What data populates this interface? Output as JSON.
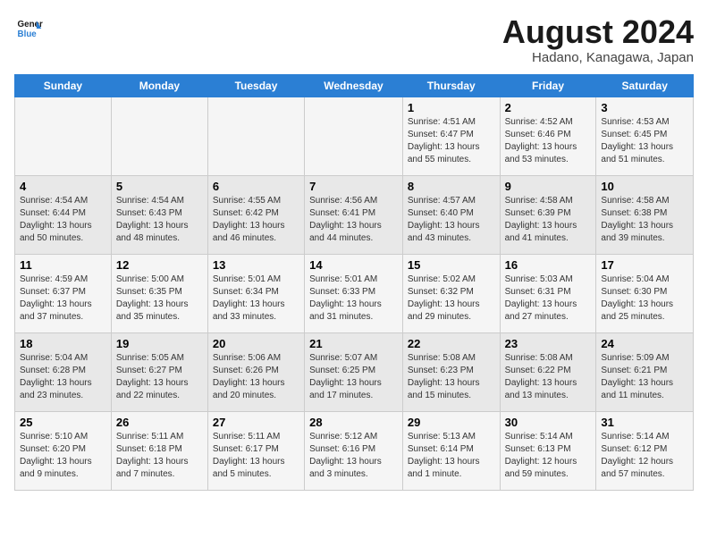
{
  "logo": {
    "line1": "General",
    "line2": "Blue"
  },
  "title": "August 2024",
  "location": "Hadano, Kanagawa, Japan",
  "days_of_week": [
    "Sunday",
    "Monday",
    "Tuesday",
    "Wednesday",
    "Thursday",
    "Friday",
    "Saturday"
  ],
  "weeks": [
    [
      {
        "day": "",
        "info": ""
      },
      {
        "day": "",
        "info": ""
      },
      {
        "day": "",
        "info": ""
      },
      {
        "day": "",
        "info": ""
      },
      {
        "day": "1",
        "info": "Sunrise: 4:51 AM\nSunset: 6:47 PM\nDaylight: 13 hours\nand 55 minutes."
      },
      {
        "day": "2",
        "info": "Sunrise: 4:52 AM\nSunset: 6:46 PM\nDaylight: 13 hours\nand 53 minutes."
      },
      {
        "day": "3",
        "info": "Sunrise: 4:53 AM\nSunset: 6:45 PM\nDaylight: 13 hours\nand 51 minutes."
      }
    ],
    [
      {
        "day": "4",
        "info": "Sunrise: 4:54 AM\nSunset: 6:44 PM\nDaylight: 13 hours\nand 50 minutes."
      },
      {
        "day": "5",
        "info": "Sunrise: 4:54 AM\nSunset: 6:43 PM\nDaylight: 13 hours\nand 48 minutes."
      },
      {
        "day": "6",
        "info": "Sunrise: 4:55 AM\nSunset: 6:42 PM\nDaylight: 13 hours\nand 46 minutes."
      },
      {
        "day": "7",
        "info": "Sunrise: 4:56 AM\nSunset: 6:41 PM\nDaylight: 13 hours\nand 44 minutes."
      },
      {
        "day": "8",
        "info": "Sunrise: 4:57 AM\nSunset: 6:40 PM\nDaylight: 13 hours\nand 43 minutes."
      },
      {
        "day": "9",
        "info": "Sunrise: 4:58 AM\nSunset: 6:39 PM\nDaylight: 13 hours\nand 41 minutes."
      },
      {
        "day": "10",
        "info": "Sunrise: 4:58 AM\nSunset: 6:38 PM\nDaylight: 13 hours\nand 39 minutes."
      }
    ],
    [
      {
        "day": "11",
        "info": "Sunrise: 4:59 AM\nSunset: 6:37 PM\nDaylight: 13 hours\nand 37 minutes."
      },
      {
        "day": "12",
        "info": "Sunrise: 5:00 AM\nSunset: 6:35 PM\nDaylight: 13 hours\nand 35 minutes."
      },
      {
        "day": "13",
        "info": "Sunrise: 5:01 AM\nSunset: 6:34 PM\nDaylight: 13 hours\nand 33 minutes."
      },
      {
        "day": "14",
        "info": "Sunrise: 5:01 AM\nSunset: 6:33 PM\nDaylight: 13 hours\nand 31 minutes."
      },
      {
        "day": "15",
        "info": "Sunrise: 5:02 AM\nSunset: 6:32 PM\nDaylight: 13 hours\nand 29 minutes."
      },
      {
        "day": "16",
        "info": "Sunrise: 5:03 AM\nSunset: 6:31 PM\nDaylight: 13 hours\nand 27 minutes."
      },
      {
        "day": "17",
        "info": "Sunrise: 5:04 AM\nSunset: 6:30 PM\nDaylight: 13 hours\nand 25 minutes."
      }
    ],
    [
      {
        "day": "18",
        "info": "Sunrise: 5:04 AM\nSunset: 6:28 PM\nDaylight: 13 hours\nand 23 minutes."
      },
      {
        "day": "19",
        "info": "Sunrise: 5:05 AM\nSunset: 6:27 PM\nDaylight: 13 hours\nand 22 minutes."
      },
      {
        "day": "20",
        "info": "Sunrise: 5:06 AM\nSunset: 6:26 PM\nDaylight: 13 hours\nand 20 minutes."
      },
      {
        "day": "21",
        "info": "Sunrise: 5:07 AM\nSunset: 6:25 PM\nDaylight: 13 hours\nand 17 minutes."
      },
      {
        "day": "22",
        "info": "Sunrise: 5:08 AM\nSunset: 6:23 PM\nDaylight: 13 hours\nand 15 minutes."
      },
      {
        "day": "23",
        "info": "Sunrise: 5:08 AM\nSunset: 6:22 PM\nDaylight: 13 hours\nand 13 minutes."
      },
      {
        "day": "24",
        "info": "Sunrise: 5:09 AM\nSunset: 6:21 PM\nDaylight: 13 hours\nand 11 minutes."
      }
    ],
    [
      {
        "day": "25",
        "info": "Sunrise: 5:10 AM\nSunset: 6:20 PM\nDaylight: 13 hours\nand 9 minutes."
      },
      {
        "day": "26",
        "info": "Sunrise: 5:11 AM\nSunset: 6:18 PM\nDaylight: 13 hours\nand 7 minutes."
      },
      {
        "day": "27",
        "info": "Sunrise: 5:11 AM\nSunset: 6:17 PM\nDaylight: 13 hours\nand 5 minutes."
      },
      {
        "day": "28",
        "info": "Sunrise: 5:12 AM\nSunset: 6:16 PM\nDaylight: 13 hours\nand 3 minutes."
      },
      {
        "day": "29",
        "info": "Sunrise: 5:13 AM\nSunset: 6:14 PM\nDaylight: 13 hours\nand 1 minute."
      },
      {
        "day": "30",
        "info": "Sunrise: 5:14 AM\nSunset: 6:13 PM\nDaylight: 12 hours\nand 59 minutes."
      },
      {
        "day": "31",
        "info": "Sunrise: 5:14 AM\nSunset: 6:12 PM\nDaylight: 12 hours\nand 57 minutes."
      }
    ]
  ]
}
